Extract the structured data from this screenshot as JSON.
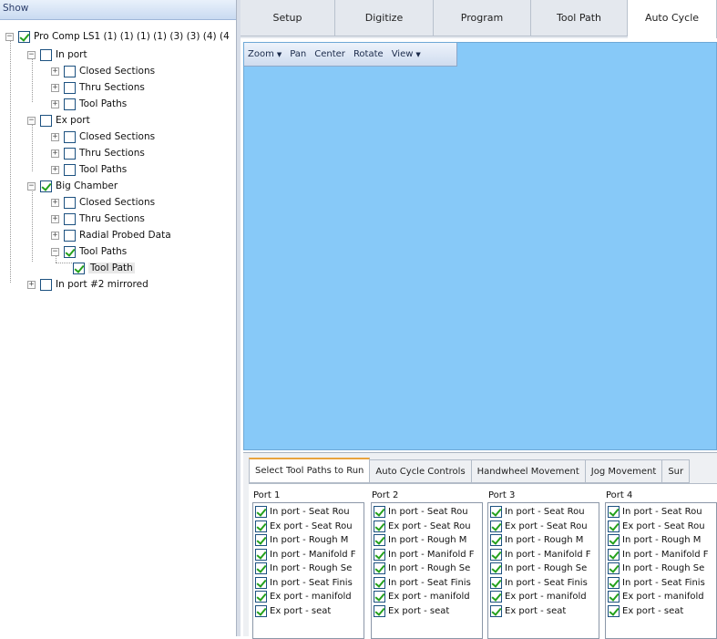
{
  "tree": {
    "header": "Show",
    "root": {
      "label": "Pro Comp LS1 (1) (1) (1) (1) (3) (3) (4) (4",
      "checked": true
    },
    "nodes": [
      {
        "label": "In port",
        "checked": false
      },
      {
        "label": "Closed Sections",
        "checked": false
      },
      {
        "label": "Thru Sections",
        "checked": false
      },
      {
        "label": "Tool Paths",
        "checked": false
      },
      {
        "label": "Ex port",
        "checked": false
      },
      {
        "label": "Closed Sections",
        "checked": false
      },
      {
        "label": "Thru Sections",
        "checked": false
      },
      {
        "label": "Tool Paths",
        "checked": false
      },
      {
        "label": "Big Chamber",
        "checked": true
      },
      {
        "label": "Closed Sections",
        "checked": false
      },
      {
        "label": "Thru Sections",
        "checked": false
      },
      {
        "label": "Radial Probed Data",
        "checked": false
      },
      {
        "label": "Tool Paths",
        "checked": true
      },
      {
        "label": "Tool Path",
        "checked": true
      },
      {
        "label": "In port #2 mirrored",
        "checked": false
      }
    ]
  },
  "top_tabs": [
    "Setup",
    "Digitize",
    "Program",
    "Tool Path",
    "Auto Cycle"
  ],
  "active_top_tab": "Auto Cycle",
  "view_toolbar": {
    "zoom": "Zoom",
    "pan": "Pan",
    "center": "Center",
    "rotate": "Rotate",
    "view": "View"
  },
  "view_background": "#87c9f8",
  "bottom_tabs": [
    "Select Tool Paths to Run",
    "Auto Cycle Controls",
    "Handwheel Movement",
    "Jog Movement",
    "Sur"
  ],
  "active_bottom_tab": "Select Tool Paths to Run",
  "ports": [
    {
      "title": "Port 1",
      "items": [
        "In port - Seat Rou",
        "Ex port - Seat Rou",
        "In port - Rough M",
        "In port - Manifold F",
        "In port - Rough Se",
        "In port - Seat Finis",
        "Ex port - manifold",
        "Ex port - seat"
      ]
    },
    {
      "title": "Port 2",
      "items": [
        "In port - Seat Rou",
        "Ex port - Seat Rou",
        "In port - Rough M",
        "In port - Manifold F",
        "In port - Rough Se",
        "In port - Seat Finis",
        "Ex port - manifold",
        "Ex port - seat"
      ]
    },
    {
      "title": "Port 3",
      "items": [
        "In port - Seat Rou",
        "Ex port - Seat Rou",
        "In port - Rough M",
        "In port - Manifold F",
        "In port - Rough Se",
        "In port - Seat Finis",
        "Ex port - manifold",
        "Ex port - seat"
      ]
    },
    {
      "title": "Port 4",
      "items": [
        "In port - Seat Rou",
        "Ex port - Seat Rou",
        "In port - Rough M",
        "In port - Manifold F",
        "In port - Rough Se",
        "In port - Seat Finis",
        "Ex port - manifold",
        "Ex port - seat"
      ]
    }
  ]
}
